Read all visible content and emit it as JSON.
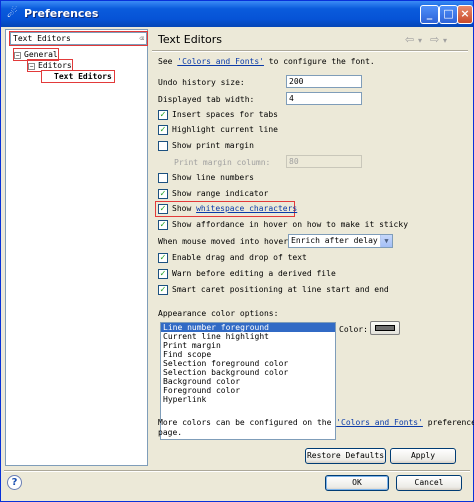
{
  "window": {
    "icon": "eclipse-icon",
    "title": "Preferences",
    "controls": {
      "minimize": "_",
      "maximize": "□",
      "close": "×"
    }
  },
  "filter": {
    "value": "Text Editors",
    "clear_icon": "clear-filter-icon",
    "clear_glyph": "⌫"
  },
  "tree": {
    "items": [
      {
        "label": "General",
        "toggle": "−"
      },
      {
        "label": "Editors",
        "toggle": "−"
      },
      {
        "label": "Text Editors"
      }
    ]
  },
  "page": {
    "title": "Text Editors",
    "nav": {
      "back": "⇦",
      "back_menu": "▾",
      "forward": "⇨",
      "forward_menu": "▾"
    },
    "intro_prefix": "See ",
    "intro_link": "'Colors and Fonts'",
    "intro_suffix": " to configure the font.",
    "undo_label": "Undo history size:",
    "undo_value": "200",
    "tab_label": "Displayed tab width:",
    "tab_value": "4",
    "options": [
      {
        "label": "Insert spaces for tabs",
        "checked": true
      },
      {
        "label": "Highlight current line",
        "checked": true
      },
      {
        "label": "Show print margin",
        "checked": false
      }
    ],
    "print_margin_label": "Print margin column:",
    "print_margin_value": "80",
    "options2": [
      {
        "label": "Show line numbers",
        "checked": false
      },
      {
        "label": "Show range indicator",
        "checked": true
      },
      {
        "label_prefix": "Show ",
        "label_link": "whitespace characters",
        "checked": true
      },
      {
        "label": "Show affordance in hover on how to make it sticky",
        "checked": true
      }
    ],
    "hover_label": "When mouse moved into hover:",
    "hover_value": "Enrich after delay",
    "options3": [
      {
        "label": "Enable drag and drop of text",
        "checked": true
      },
      {
        "label": "Warn before editing a derived file",
        "checked": true
      },
      {
        "label": "Smart caret positioning at line start and end",
        "checked": true
      }
    ],
    "appearance_label": "Appearance color options:",
    "color_items": [
      "Line number foreground",
      "Current line highlight",
      "Print margin",
      "Find scope",
      "Selection foreground color",
      "Selection background color",
      "Background color",
      "Foreground color",
      "Hyperlink"
    ],
    "selected_color_index": 0,
    "color_label": "Color:",
    "color_value": "#6e6e6e",
    "more_prefix": "More colors can be configured on the ",
    "more_link": "'Colors and Fonts'",
    "more_suffix": " preference",
    "more_line2": "page.",
    "restore_label": "Restore Defaults",
    "apply_label": "Apply"
  },
  "footer": {
    "help_glyph": "?",
    "ok_label": "OK",
    "cancel_label": "Cancel"
  },
  "colors": {
    "title_bar": "#0653d6",
    "highlight_outline": "#e23a3a",
    "selection": "#316ac5",
    "link": "#0a3aa8",
    "checkmark": "#21a121"
  }
}
